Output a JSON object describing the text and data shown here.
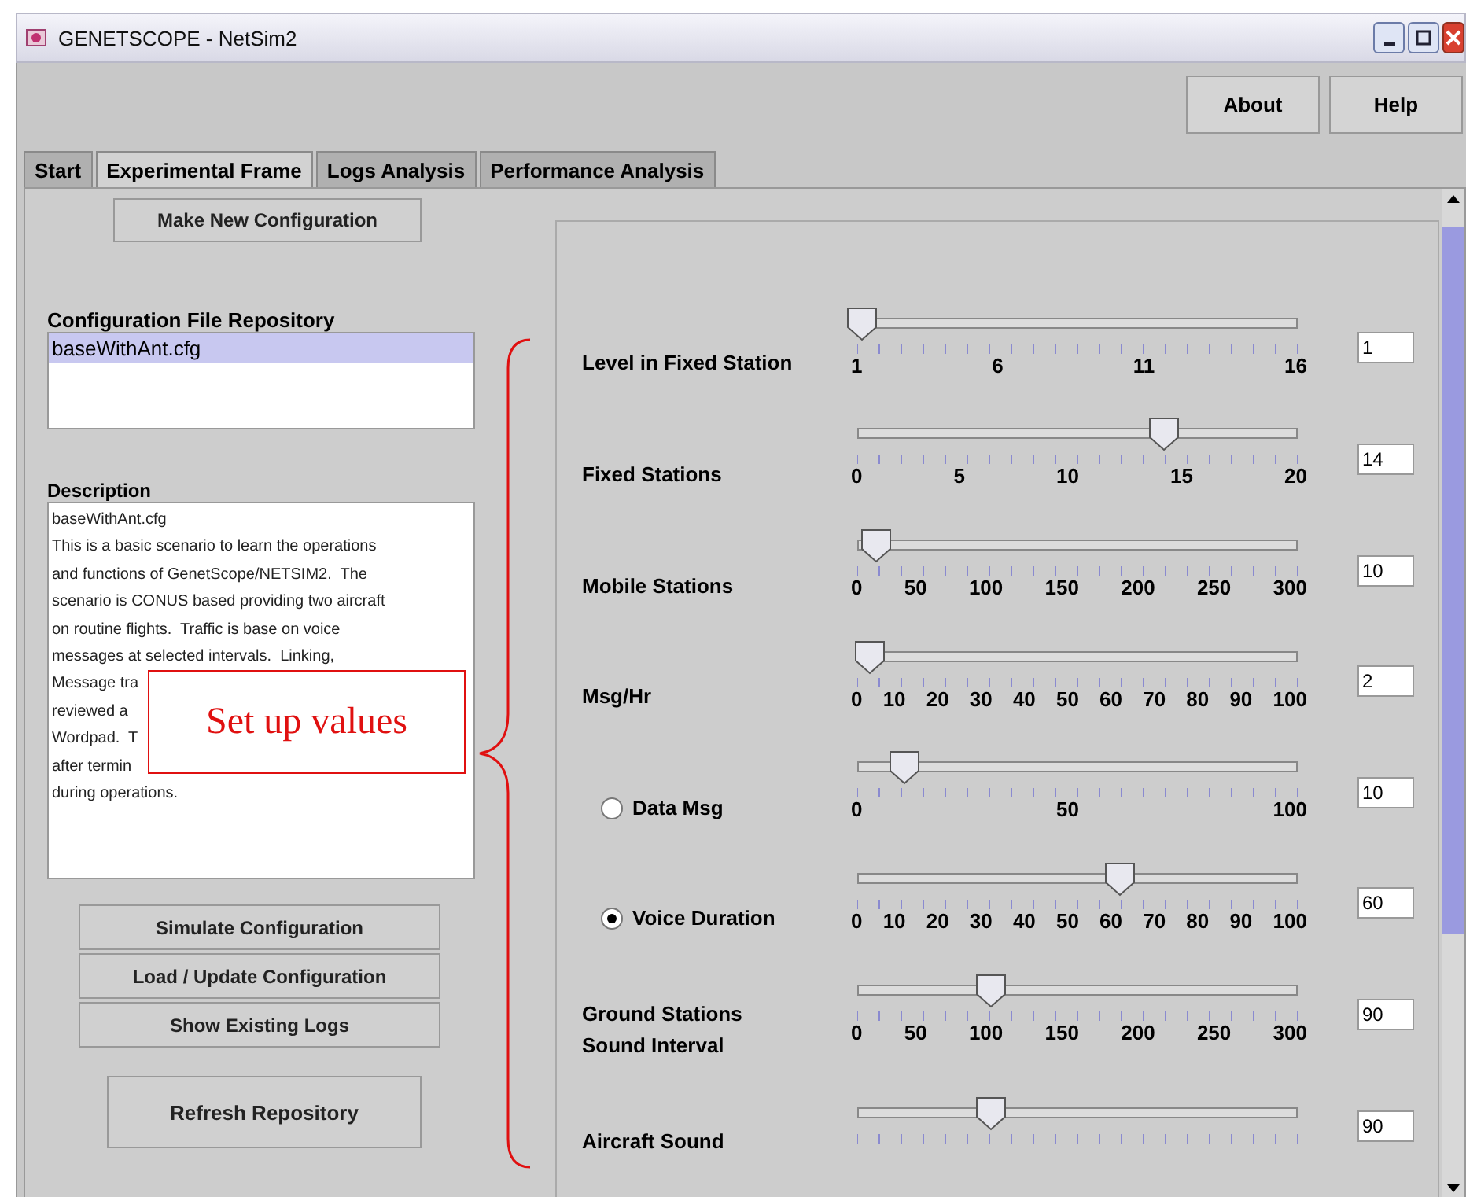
{
  "window": {
    "title": "GENETSCOPE - NetSim2"
  },
  "top_buttons": [
    "About",
    "Help"
  ],
  "tabs": [
    {
      "label": "Start",
      "selected": false
    },
    {
      "label": "Experimental Frame",
      "selected": true
    },
    {
      "label": "Logs Analysis",
      "selected": false
    },
    {
      "label": "Performance Analysis",
      "selected": false
    }
  ],
  "left_panel": {
    "make_button": "Make New Configuration",
    "repository": {
      "label": "Configuration File Repository",
      "items": [
        {
          "name": "baseWithAnt.cfg",
          "selected": true
        }
      ]
    },
    "description": {
      "label": "Description",
      "lines": [
        "baseWithAnt.cfg",
        "This is a basic scenario to learn the operations",
        "and functions of GenetScope/NETSIM2.  The",
        "scenario is CONUS based providing two aircraft",
        "on routine flights.  Traffic is base on voice",
        "messages at selected intervals.  Linking,",
        "Message tra",
        "reviewed a",
        "Wordpad.  T",
        "after termin",
        "during operations."
      ]
    },
    "action_buttons": [
      "Simulate Configuration",
      "Load / Update Configuration",
      "Show Existing Logs"
    ],
    "refresh_button": "Refresh Repository"
  },
  "callout": {
    "text": "Set up values"
  },
  "sliders": [
    {
      "kind": "plain",
      "label": [
        "Level in Fixed Station"
      ],
      "level": 0,
      "value": "1",
      "tick_labels": [
        "1",
        "6",
        "11",
        "16"
      ]
    },
    {
      "kind": "plain",
      "label": [
        "Fixed Stations"
      ],
      "level": 0.7,
      "value": "14",
      "tick_labels": [
        "0",
        "5",
        "10",
        "15",
        "20"
      ]
    },
    {
      "kind": "plain",
      "label": [
        "Mobile Stations"
      ],
      "level": 0.033,
      "value": "10",
      "tick_labels": [
        "0",
        "50",
        "100",
        "150",
        "200",
        "250",
        "300"
      ]
    },
    {
      "kind": "plain",
      "label": [
        "Msg/Hr"
      ],
      "level": 0.02,
      "value": "2",
      "tick_labels": [
        "0",
        "10",
        "20",
        "30",
        "40",
        "50",
        "60",
        "70",
        "80",
        "90",
        "100"
      ]
    },
    {
      "kind": "radio",
      "selected": false,
      "label": [
        "Data Msg"
      ],
      "level": 0.1,
      "value": "10",
      "tick_labels": [
        "0",
        "50",
        "100"
      ]
    },
    {
      "kind": "radio",
      "selected": true,
      "label": [
        "Voice Duration"
      ],
      "level": 0.6,
      "value": "60",
      "tick_labels": [
        "0",
        "10",
        "20",
        "30",
        "40",
        "50",
        "60",
        "70",
        "80",
        "90",
        "100"
      ]
    },
    {
      "kind": "plain",
      "label": [
        "Ground Stations",
        "Sound Interval"
      ],
      "level": 0.3,
      "value": "90",
      "tick_labels": [
        "0",
        "50",
        "100",
        "150",
        "200",
        "250",
        "300"
      ]
    },
    {
      "kind": "plain",
      "label": [
        "Aircraft Sound"
      ],
      "level": 0.3,
      "value": "90"
    }
  ]
}
